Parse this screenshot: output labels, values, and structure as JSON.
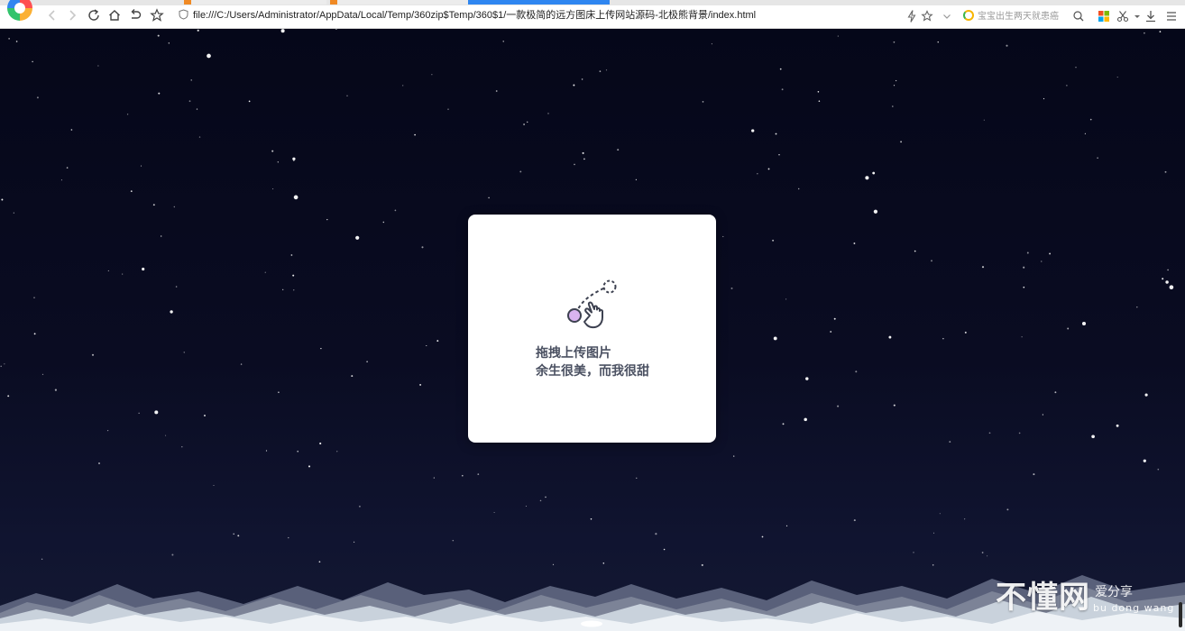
{
  "browser": {
    "address_url": "file:///C:/Users/Administrator/AppData/Local/Temp/360zip$Temp/360$1/一款极简的远方图床上传网站源码-北极熊背景/index.html",
    "search_hint": "宝宝出生两天就患癌",
    "icons": [
      "back-icon",
      "forward-icon",
      "reload-icon",
      "home-icon",
      "undo-icon",
      "star-icon",
      "shield-icon",
      "lightning-icon",
      "bookmark-star-icon",
      "dropdown-icon",
      "search-icon",
      "apps-icon",
      "scissors-icon",
      "download-icon",
      "menu-icon"
    ],
    "accent_color": "#2f86f0"
  },
  "upload_card": {
    "title": "拖拽上传图片",
    "subtitle": "余生很美，而我很甜",
    "icon": "drag-hand-icon",
    "icon_accent": "#d9b3f0"
  },
  "watermark": {
    "main": "不懂网",
    "side": "爱分享",
    "sub": "bu dong wang"
  },
  "colors": {
    "sky_top": "#050719",
    "sky_bottom": "#141932",
    "snow": "#eef2f6"
  }
}
